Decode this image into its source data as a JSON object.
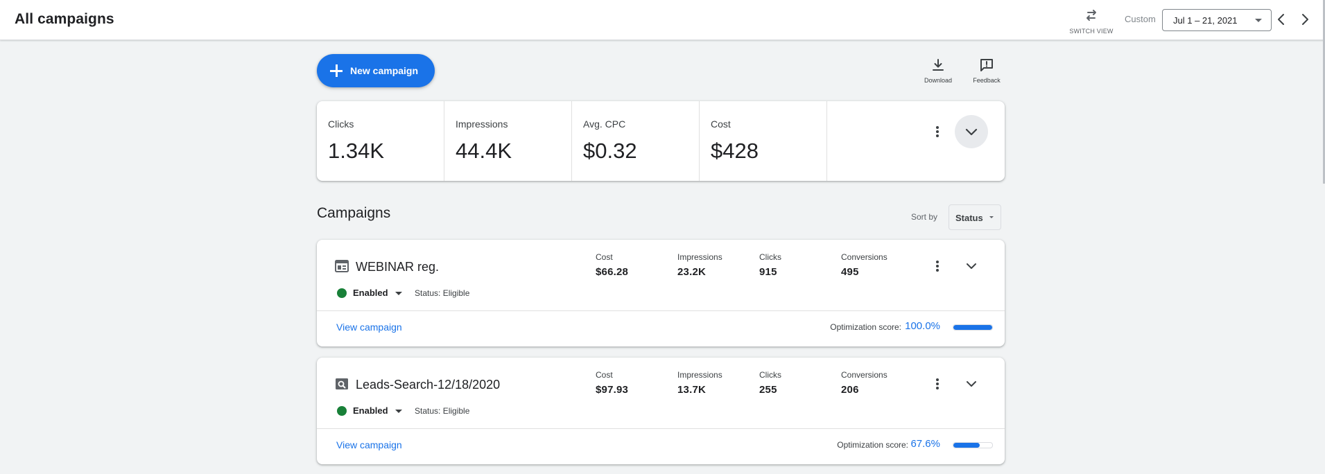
{
  "header": {
    "title": "All campaigns",
    "switch_view_label": "SWITCH VIEW",
    "custom_label": "Custom",
    "date_range": "Jul 1 – 21, 2021"
  },
  "actions": {
    "new_campaign_label": "New campaign",
    "download_label": "Download",
    "feedback_label": "Feedback"
  },
  "summary": {
    "metrics": [
      {
        "name": "Clicks",
        "value": "1.34K"
      },
      {
        "name": "Impressions",
        "value": "44.4K"
      },
      {
        "name": "Avg. CPC",
        "value": "$0.32"
      },
      {
        "name": "Cost",
        "value": "$428"
      }
    ]
  },
  "campaigns_section": {
    "title": "Campaigns",
    "sort_label": "Sort by",
    "sort_value": "Status"
  },
  "campaigns": [
    {
      "name": "WEBINAR reg.",
      "type_icon": "display-campaign-icon",
      "state": "Enabled",
      "status": "Status: Eligible",
      "stats": [
        {
          "k": "Cost",
          "v": "$66.28"
        },
        {
          "k": "Impressions",
          "v": "23.2K"
        },
        {
          "k": "Clicks",
          "v": "915"
        },
        {
          "k": "Conversions",
          "v": "495"
        }
      ],
      "view_label": "View campaign",
      "opt_label": "Optimization score:",
      "opt_value": "100.0%",
      "opt_fraction": 1.0
    },
    {
      "name": "Leads-Search-12/18/2020",
      "type_icon": "search-campaign-icon",
      "state": "Enabled",
      "status": "Status: Eligible",
      "stats": [
        {
          "k": "Cost",
          "v": "$97.93"
        },
        {
          "k": "Impressions",
          "v": "13.7K"
        },
        {
          "k": "Clicks",
          "v": "255"
        },
        {
          "k": "Conversions",
          "v": "206"
        }
      ],
      "view_label": "View campaign",
      "opt_label": "Optimization score:",
      "opt_value": "67.6%",
      "opt_fraction": 0.676
    }
  ],
  "colors": {
    "accent": "#1a73e8",
    "enabled": "#188038",
    "background": "#f1f3f4"
  }
}
